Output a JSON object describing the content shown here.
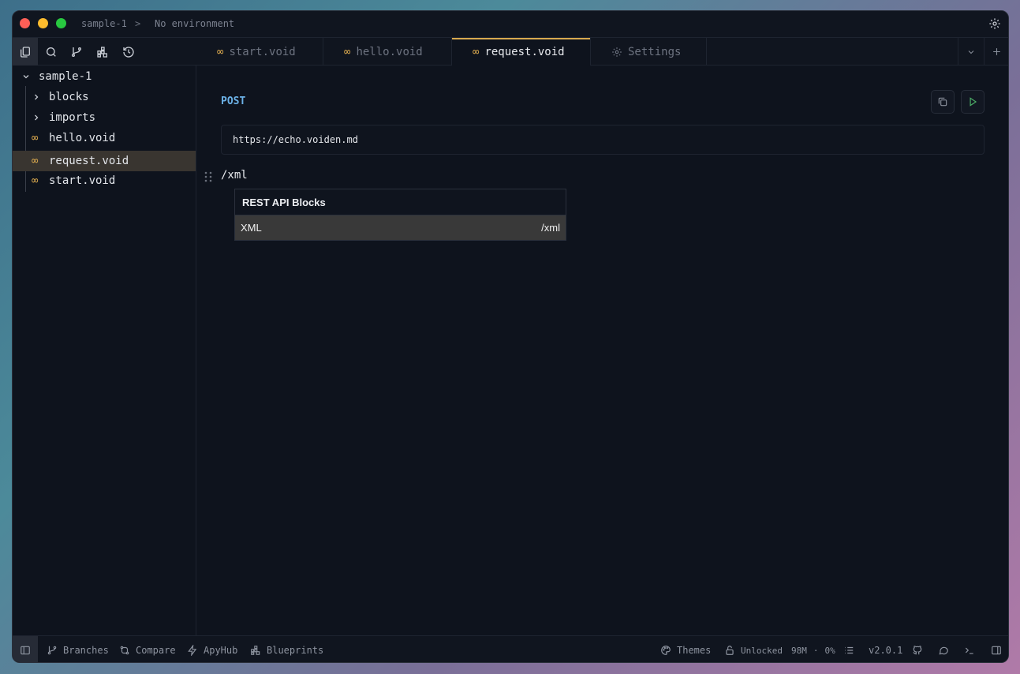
{
  "titlebar": {
    "project": "sample-1",
    "separator": ">",
    "environment": "No environment"
  },
  "tabs": [
    {
      "label": "start.void",
      "icon": "infinity-icon",
      "active": false
    },
    {
      "label": "hello.void",
      "icon": "infinity-icon",
      "active": false
    },
    {
      "label": "request.void",
      "icon": "infinity-icon",
      "active": true
    },
    {
      "label": "Settings",
      "icon": "gear-icon",
      "active": false
    }
  ],
  "tab_icon_glyph": "∞",
  "sidebar": {
    "root": "sample-1",
    "items": [
      {
        "label": "blocks",
        "type": "folder"
      },
      {
        "label": "imports",
        "type": "folder"
      },
      {
        "label": "hello.void",
        "type": "file"
      },
      {
        "label": "request.void",
        "type": "file",
        "selected": true
      },
      {
        "label": "start.void",
        "type": "file"
      }
    ]
  },
  "editor": {
    "method": "POST",
    "url": "https://echo.voiden.md",
    "slash_command": "/xml",
    "popup": {
      "heading": "REST API Blocks",
      "item_label": "XML",
      "item_shortcut": "/xml"
    }
  },
  "statusbar": {
    "branches": "Branches",
    "compare": "Compare",
    "apyhub": "ApyHub",
    "blueprints": "Blueprints",
    "themes": "Themes",
    "unlocked": "Unlocked",
    "memory": "98M",
    "dot": "·",
    "cpu": "0%",
    "version": "v2.0.1"
  },
  "colors": {
    "accent": "#d8a94e",
    "method": "#6cb2e8",
    "run": "#4caf68",
    "selected_row": "#393530"
  }
}
